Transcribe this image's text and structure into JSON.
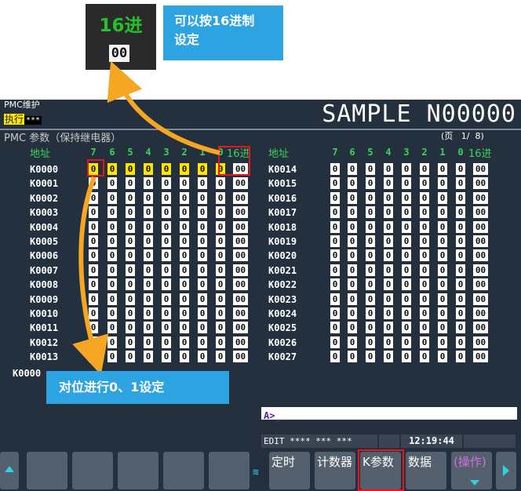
{
  "zoom": {
    "label": "16进",
    "value": "00"
  },
  "callouts": {
    "hex": [
      "可以按16进制",
      "设定"
    ],
    "bit": "对位进行0、1设定"
  },
  "header": {
    "pmc": "PMC维护",
    "exec_label": "执行",
    "exec_value": "***",
    "program": "SAMPLE N00000"
  },
  "title": "PMC 参数（保持继电器）",
  "page": {
    "text": "(页   1/  8)"
  },
  "columns": {
    "address": "地址",
    "bits": [
      "7",
      "6",
      "5",
      "4",
      "3",
      "2",
      "1",
      "0"
    ],
    "hex": "16进"
  },
  "rows_left": [
    {
      "addr": "K0000",
      "bits": [
        "0",
        "0",
        "0",
        "0",
        "0",
        "0",
        "0",
        "0"
      ],
      "hex": "00"
    },
    {
      "addr": "K0001",
      "bits": [
        "0",
        "0",
        "0",
        "0",
        "0",
        "0",
        "0",
        "0"
      ],
      "hex": "00"
    },
    {
      "addr": "K0002",
      "bits": [
        "0",
        "0",
        "0",
        "0",
        "0",
        "0",
        "0",
        "0"
      ],
      "hex": "00"
    },
    {
      "addr": "K0003",
      "bits": [
        "0",
        "0",
        "0",
        "0",
        "0",
        "0",
        "0",
        "0"
      ],
      "hex": "00"
    },
    {
      "addr": "K0004",
      "bits": [
        "0",
        "0",
        "0",
        "0",
        "0",
        "0",
        "0",
        "0"
      ],
      "hex": "00"
    },
    {
      "addr": "K0005",
      "bits": [
        "0",
        "0",
        "0",
        "0",
        "0",
        "0",
        "0",
        "0"
      ],
      "hex": "00"
    },
    {
      "addr": "K0006",
      "bits": [
        "0",
        "0",
        "0",
        "0",
        "0",
        "0",
        "0",
        "0"
      ],
      "hex": "00"
    },
    {
      "addr": "K0007",
      "bits": [
        "0",
        "0",
        "0",
        "0",
        "0",
        "0",
        "0",
        "0"
      ],
      "hex": "00"
    },
    {
      "addr": "K0008",
      "bits": [
        "0",
        "0",
        "0",
        "0",
        "0",
        "0",
        "0",
        "0"
      ],
      "hex": "00"
    },
    {
      "addr": "K0009",
      "bits": [
        "0",
        "0",
        "0",
        "0",
        "0",
        "0",
        "0",
        "0"
      ],
      "hex": "00"
    },
    {
      "addr": "K0010",
      "bits": [
        "0",
        "0",
        "0",
        "0",
        "0",
        "0",
        "0",
        "0"
      ],
      "hex": "00"
    },
    {
      "addr": "K0011",
      "bits": [
        "0",
        "0",
        "0",
        "0",
        "0",
        "0",
        "0",
        "0"
      ],
      "hex": "00"
    },
    {
      "addr": "K0012",
      "bits": [
        "0",
        "0",
        "0",
        "0",
        "0",
        "0",
        "0",
        "0"
      ],
      "hex": "00"
    },
    {
      "addr": "K0013",
      "bits": [
        "0",
        "0",
        "0",
        "0",
        "0",
        "0",
        "0",
        "0"
      ],
      "hex": "00"
    }
  ],
  "rows_right": [
    {
      "addr": "K0014",
      "bits": [
        "0",
        "0",
        "0",
        "0",
        "0",
        "0",
        "0",
        "0"
      ],
      "hex": "00"
    },
    {
      "addr": "K0015",
      "bits": [
        "0",
        "0",
        "0",
        "0",
        "0",
        "0",
        "0",
        "0"
      ],
      "hex": "00"
    },
    {
      "addr": "K0016",
      "bits": [
        "0",
        "0",
        "0",
        "0",
        "0",
        "0",
        "0",
        "0"
      ],
      "hex": "00"
    },
    {
      "addr": "K0017",
      "bits": [
        "0",
        "0",
        "0",
        "0",
        "0",
        "0",
        "0",
        "0"
      ],
      "hex": "00"
    },
    {
      "addr": "K0018",
      "bits": [
        "0",
        "0",
        "0",
        "0",
        "0",
        "0",
        "0",
        "0"
      ],
      "hex": "00"
    },
    {
      "addr": "K0019",
      "bits": [
        "0",
        "0",
        "0",
        "0",
        "0",
        "0",
        "0",
        "0"
      ],
      "hex": "00"
    },
    {
      "addr": "K0020",
      "bits": [
        "0",
        "0",
        "0",
        "0",
        "0",
        "0",
        "0",
        "0"
      ],
      "hex": "00"
    },
    {
      "addr": "K0021",
      "bits": [
        "0",
        "0",
        "0",
        "0",
        "0",
        "0",
        "0",
        "0"
      ],
      "hex": "00"
    },
    {
      "addr": "K0022",
      "bits": [
        "0",
        "0",
        "0",
        "0",
        "0",
        "0",
        "0",
        "0"
      ],
      "hex": "00"
    },
    {
      "addr": "K0023",
      "bits": [
        "0",
        "0",
        "0",
        "0",
        "0",
        "0",
        "0",
        "0"
      ],
      "hex": "00"
    },
    {
      "addr": "K0024",
      "bits": [
        "0",
        "0",
        "0",
        "0",
        "0",
        "0",
        "0",
        "0"
      ],
      "hex": "00"
    },
    {
      "addr": "K0025",
      "bits": [
        "0",
        "0",
        "0",
        "0",
        "0",
        "0",
        "0",
        "0"
      ],
      "hex": "00"
    },
    {
      "addr": "K0026",
      "bits": [
        "0",
        "0",
        "0",
        "0",
        "0",
        "0",
        "0",
        "0"
      ],
      "hex": "00"
    },
    {
      "addr": "K0027",
      "bits": [
        "0",
        "0",
        "0",
        "0",
        "0",
        "0",
        "0",
        "0"
      ],
      "hex": "00"
    }
  ],
  "current_address": "K0000",
  "input": {
    "prompt": "A>_"
  },
  "status": {
    "mode": "EDIT **** *** ***",
    "clock": "12:19:44"
  },
  "softkeys": [
    "定时",
    "计数器",
    "K参数",
    "数据",
    "(操作)"
  ],
  "colors": {
    "screen_bg": "#24303d",
    "bit_header": "#3cd25a",
    "cursor": "#ffe600",
    "highlight": "#e8141f",
    "callout": "#2ea3e2",
    "arrow": "#f5a623"
  }
}
